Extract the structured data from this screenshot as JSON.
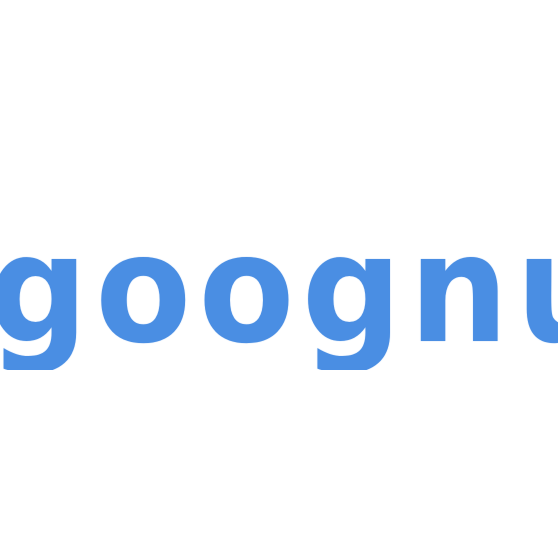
{
  "logo": {
    "text": "goognu",
    "color": "#4a8ee3"
  },
  "background": "#ffffff"
}
